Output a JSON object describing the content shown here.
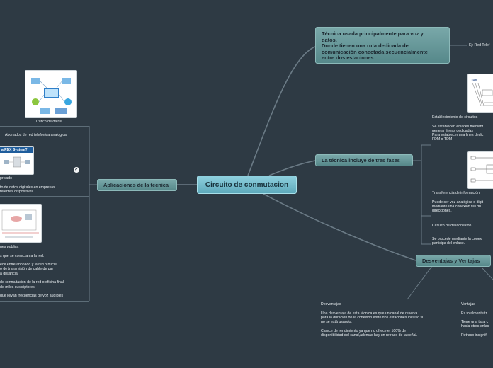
{
  "central": {
    "label": "Circuito de conmutacion"
  },
  "right": {
    "tecnica": {
      "line1": "Técnica usada principalmente para voz y",
      "line2": "datos.",
      "line3": "Donde tienen una ruta dedicada de",
      "line4": "comunicación conectada secuencialmente",
      "line5": "entre dos estaciones",
      "child": "Ej: Red Telef"
    },
    "fases": {
      "label": "La técnica incluye de tres fases",
      "establecimiento": "Establecimiento de circuitos\n\nSe establecen enlaces mediant\ngenerar lineas dedicadas\nPara establecer una lines dedic\nFDM o TDM",
      "transferencia": "Transferencia de información\n\nPuede ser voz analógica o digit\nmediante una conexión full du\ndirecciones.",
      "desconexion": "Circuito de desconexión\n\n\nSe procede mediante la conexi\nparticipa del enlace."
    },
    "desventajas_ventajas": {
      "label": "Desventajas y Ventajas",
      "desventajas": "Desventajas\n\nUna desventaja de esta técnica es que un canal de reserva\npara la duración de la conexión entre dos estaciones incluso si\nno se está usando.\n\nCarece de rendimiento ya que no ofrece el 100% de\ndisponibilidad del canal,ademas hay un retraso de la señal.",
      "ventajas": "Ventajas\n\nEs totalmente tr\n\nTiene una taza c\nhacia otros enlac\n\nRetraso insignifi"
    }
  },
  "left": {
    "aplicaciones": {
      "label": "Aplicaciones de la tecnica"
    },
    "trafico": "Tráfico de datos",
    "abonados": "Abonados de red telefónica analogica",
    "pbx_banner": "a PBX System?",
    "privado": "privado\n\nto de datos digitales en empresas\nferentes dispositivos",
    "publica": "nes publica\n\ns que se conectan a la red.\n\nece entre abonado y la red o bucle\no de transmisión de cable de par\na distancia.\n\nde conmutación de la red o oficina final,\nde miles suscriptores.\n\n que llevan frecuencias de voz audibles"
  },
  "colors": {
    "background": "#2e3a44",
    "central": "#7bc0d0",
    "main_node": "#6a9a9b",
    "link": "#6b7b86"
  },
  "icons": [
    "network-illustration",
    "pbx-illustration",
    "phone-network-illustration",
    "tdm-illustration",
    "transfer-illustration",
    "check-icon"
  ]
}
